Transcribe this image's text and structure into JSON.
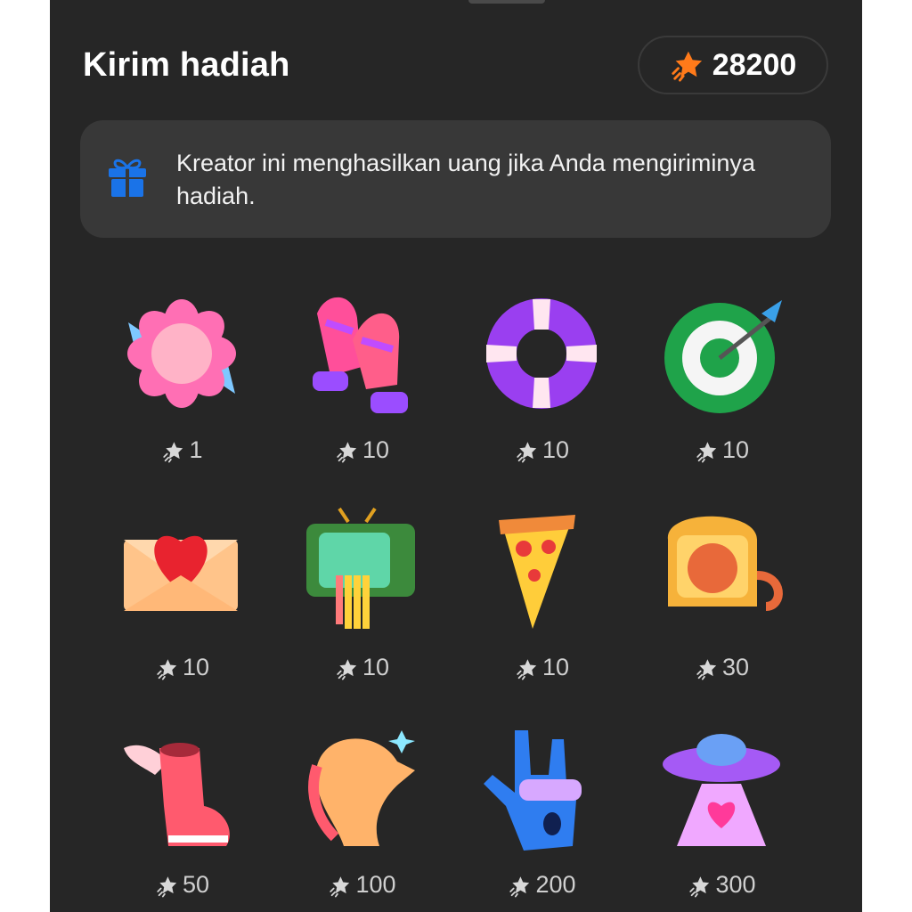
{
  "header": {
    "title": "Kirim hadiah",
    "balance": "28200",
    "balance_icon": "star-coin-icon"
  },
  "banner": {
    "icon": "gift-icon",
    "text": "Kreator ini menghasilkan uang jika Anda mengiriminya hadiah."
  },
  "colors": {
    "background": "#262626",
    "banner": "#383838",
    "accent": "#ff7a1a",
    "gift_blue": "#1a73e8"
  },
  "gifts": [
    {
      "name": "flower",
      "price": "1"
    },
    {
      "name": "mittens",
      "price": "10"
    },
    {
      "name": "life-ring",
      "price": "10"
    },
    {
      "name": "target",
      "price": "10"
    },
    {
      "name": "love-letter",
      "price": "10"
    },
    {
      "name": "rainbow-tv",
      "price": "10"
    },
    {
      "name": "pizza",
      "price": "10"
    },
    {
      "name": "toast-cat",
      "price": "30"
    },
    {
      "name": "winged-sneaker",
      "price": "50"
    },
    {
      "name": "dragon",
      "price": "100"
    },
    {
      "name": "rock-hand",
      "price": "200"
    },
    {
      "name": "ufo",
      "price": "300"
    }
  ]
}
